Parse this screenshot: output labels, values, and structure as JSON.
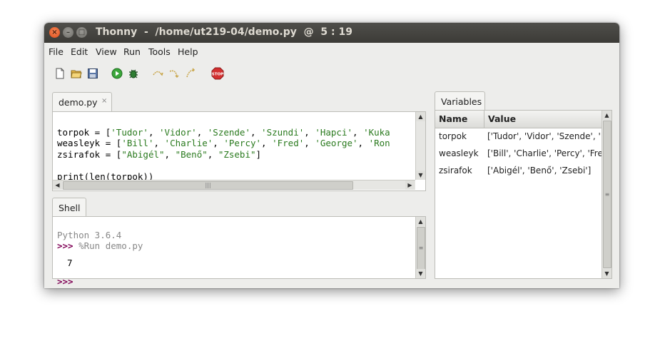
{
  "window": {
    "title": "Thonny  -  /home/ut219-04/demo.py  @  5 : 19",
    "controls": [
      "close",
      "minimize",
      "maximize"
    ]
  },
  "menu": [
    "File",
    "Edit",
    "View",
    "Run",
    "Tools",
    "Help"
  ],
  "toolbar": {
    "icons": [
      "new-file-icon",
      "open-file-icon",
      "save-icon",
      "run-icon",
      "debug-icon",
      "step-over-icon",
      "step-into-icon",
      "step-out-icon",
      "stop-icon"
    ],
    "stop_label": "STOP"
  },
  "editor": {
    "tab_label": "demo.py",
    "tab_close": "×",
    "lines": {
      "l1": {
        "name": "torpok",
        "op": " = [",
        "items": [
          "'Tudor'",
          "'Vidor'",
          "'Szende'",
          "'Szundi'",
          "'Hapci'",
          "'Kuka"
        ]
      },
      "l2": {
        "name": "weasleyk",
        "op": " = [",
        "items": [
          "'Bill'",
          "'Charlie'",
          "'Percy'",
          "'Fred'",
          "'George'",
          "'Ron"
        ]
      },
      "l3": {
        "name": "zsirafok",
        "op": " = [",
        "items": [
          "\"Abigél\"",
          "\"Benő\"",
          "\"Zsebi\""
        ],
        "end": "]"
      },
      "l5": "print(len(torpok))"
    }
  },
  "shell": {
    "tab_label": "Shell",
    "version": "Python 3.6.4",
    "prompt": ">>>",
    "command": " %Run demo.py",
    "output": "7"
  },
  "variables": {
    "tab_label": "Variables",
    "columns": [
      "Name",
      "Value"
    ],
    "rows": [
      {
        "name": "torpok",
        "value": "['Tudor', 'Vidor', 'Szende', '"
      },
      {
        "name": "weasleyk",
        "value": "['Bill', 'Charlie', 'Percy', 'Fre"
      },
      {
        "name": "zsirafok",
        "value": "['Abigél', 'Benő', 'Zsebi']"
      }
    ]
  },
  "colors": {
    "titlebar": "#3c3b37",
    "string": "#2a7a1e",
    "prompt": "#7f0055",
    "version": "#888888"
  }
}
